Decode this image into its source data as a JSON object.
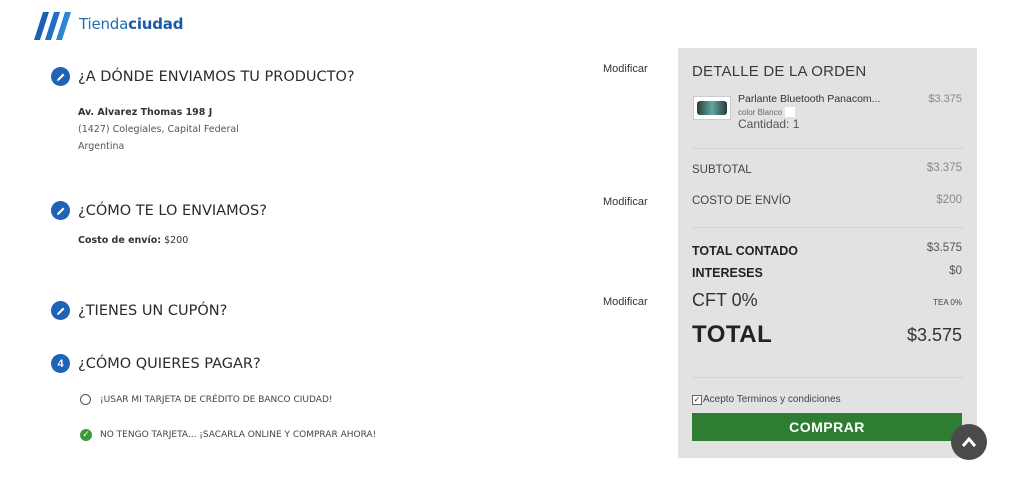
{
  "logo": {
    "text_light": "Tienda",
    "text_bold": "ciudad"
  },
  "steps": [
    {
      "icon": "pencil-icon",
      "title": "¿A DÓNDE ENVIAMOS TU PRODUCTO?",
      "action": "Modificar"
    },
    {
      "icon": "pencil-icon",
      "title": "¿CÓMO TE LO ENVIAMOS?",
      "action": "Modificar"
    },
    {
      "icon": "pencil-icon",
      "title": "¿TIENES UN CUPÓN?",
      "action": "Modificar"
    },
    {
      "number": "4",
      "title": "¿CÓMO QUIERES PAGAR?"
    }
  ],
  "address": {
    "street": "Av. Alvarez Thomas 198 J",
    "city": "(1427) Colegiales, Capital Federal",
    "country": "Argentina"
  },
  "shipping": {
    "label": "Costo de envío:",
    "value": "$200"
  },
  "payment_options": [
    {
      "label": "¡USAR MI TARJETA DE CRÉDITO DE BANCO CIUDAD!",
      "selected": false
    },
    {
      "label": "NO TENGO TARJETA... ¡SACARLA ONLINE Y COMPRAR AHORA!",
      "selected": true
    }
  ],
  "order": {
    "title": "DETALLE DE LA ORDEN",
    "product": {
      "name": "Parlante Bluetooth Panacom...",
      "color_label": "color Blanco",
      "qty": "Cantidad: 1",
      "price": "$3.375"
    },
    "subtotal_label": "SUBTOTAL",
    "subtotal": "$3.375",
    "shipping_label": "COSTO DE ENVÍO",
    "shipping": "$200",
    "total_contado_label": "TOTAL CONTADO",
    "total_contado": "$3.575",
    "intereses_label": "INTERESES",
    "intereses": "$0",
    "cft": "CFT 0%",
    "tea": "TEA 0%",
    "total_label": "TOTAL",
    "total": "$3.575",
    "terms": "Acepto Terminos y condiciones",
    "terms_checked": true,
    "button": "COMPRAR"
  },
  "colors": {
    "brand_blue": "#1d63b8",
    "panel_bg": "#e2e2e2",
    "buy_green": "#2e7d32",
    "check_green": "#3a9a3a"
  }
}
